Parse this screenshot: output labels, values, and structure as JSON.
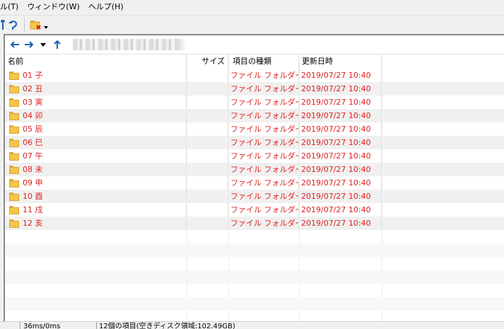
{
  "menu": [
    "ル(T)",
    "ウィンドウ(W)",
    "ヘルプ(H)"
  ],
  "columns": {
    "name": "名前",
    "size": "サイズ",
    "type": "項目の種類",
    "date": "更新日時"
  },
  "files": [
    {
      "name": "01 子",
      "size": "",
      "type": "ファイル フォルダー",
      "date": "2019/07/27 10:40"
    },
    {
      "name": "02 丑",
      "size": "",
      "type": "ファイル フォルダー",
      "date": "2019/07/27 10:40"
    },
    {
      "name": "03 寅",
      "size": "",
      "type": "ファイル フォルダー",
      "date": "2019/07/27 10:40"
    },
    {
      "name": "04 卯",
      "size": "",
      "type": "ファイル フォルダー",
      "date": "2019/07/27 10:40"
    },
    {
      "name": "05 辰",
      "size": "",
      "type": "ファイル フォルダー",
      "date": "2019/07/27 10:40"
    },
    {
      "name": "06 巳",
      "size": "",
      "type": "ファイル フォルダー",
      "date": "2019/07/27 10:40"
    },
    {
      "name": "07 午",
      "size": "",
      "type": "ファイル フォルダー",
      "date": "2019/07/27 10:40"
    },
    {
      "name": "08 未",
      "size": "",
      "type": "ファイル フォルダー",
      "date": "2019/07/27 10:40"
    },
    {
      "name": "09 申",
      "size": "",
      "type": "ファイル フォルダー",
      "date": "2019/07/27 10:40"
    },
    {
      "name": "10 酉",
      "size": "",
      "type": "ファイル フォルダー",
      "date": "2019/07/27 10:40"
    },
    {
      "name": "11 戌",
      "size": "",
      "type": "ファイル フォルダー",
      "date": "2019/07/27 10:40"
    },
    {
      "name": "12 亥",
      "size": "",
      "type": "ファイル フォルダー",
      "date": "2019/07/27 10:40"
    }
  ],
  "status": {
    "timing": "36ms/0ms",
    "summary": "12個の項目(空きディスク領域:102.49GB)"
  },
  "colors": {
    "accent": "#1a5fb4",
    "item_text": "#e02020",
    "folder": "#f5c64a"
  },
  "icons": {
    "up": "up-arrow-icon",
    "redo": "redo-icon",
    "delete": "delete-folder-icon",
    "back": "back-arrow-icon",
    "forward": "forward-arrow-icon",
    "history": "dropdown-icon"
  }
}
